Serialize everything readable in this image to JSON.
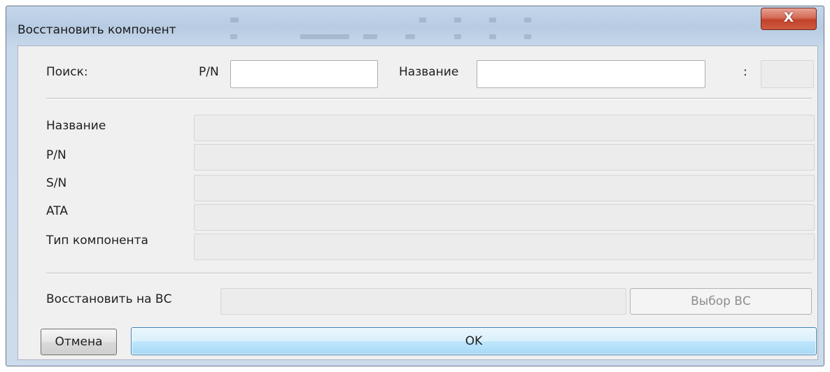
{
  "window": {
    "title": "Восстановить компонент",
    "close_glyph": "X"
  },
  "search": {
    "label": "Поиск:",
    "pn_label": "P/N",
    "pn_value": "",
    "name_label": "Название",
    "name_value": "",
    "colon_label": ":",
    "extra_value": ""
  },
  "details": {
    "rows": [
      {
        "label": "Название",
        "value": ""
      },
      {
        "label": "P/N",
        "value": ""
      },
      {
        "label": "S/N",
        "value": ""
      },
      {
        "label": "ATA",
        "value": ""
      },
      {
        "label": "Тип компонента",
        "value": ""
      }
    ]
  },
  "restore": {
    "label": "Восстановить на ВС",
    "value": "",
    "pick_button": "Выбор ВС"
  },
  "actions": {
    "cancel": "Отмена",
    "ok": "OK"
  }
}
